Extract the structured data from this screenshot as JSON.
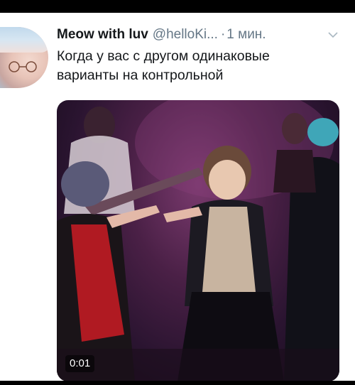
{
  "tweet": {
    "display_name": "Meow with luv",
    "handle": "@helloKi...",
    "separator": "·",
    "time": "1 мин.",
    "text_line1": "Когда у вас с другом одинаковые",
    "text_line2": "варианты на контрольной"
  },
  "media": {
    "video_time": "0:01"
  },
  "icons": {
    "menu": "chevron-down-icon",
    "avatar": "avatar-image"
  },
  "colors": {
    "text": "#14171a",
    "secondary": "#657786",
    "background": "#ffffff"
  }
}
